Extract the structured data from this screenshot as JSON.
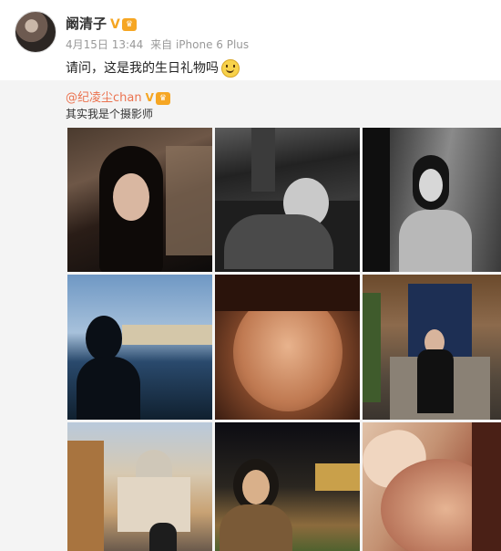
{
  "post": {
    "author": "阚清子",
    "verified_mark": "V",
    "vip_badge": "♛",
    "date": "4月15日 13:44",
    "source": "来自 iPhone 6 Plus",
    "text": "请问，这是我的生日礼物吗"
  },
  "repost": {
    "author": "@纪凌尘chan",
    "verified_mark": "V",
    "vip_badge": "♛",
    "text": "其实我是个摄影师"
  }
}
